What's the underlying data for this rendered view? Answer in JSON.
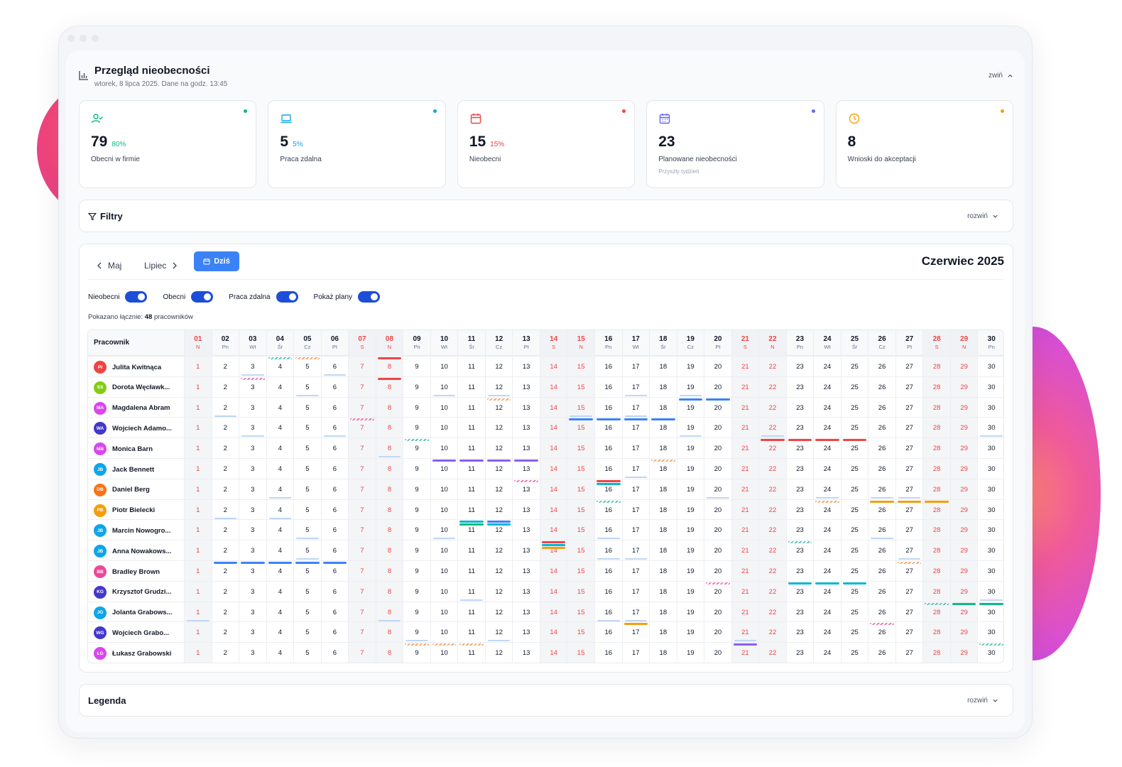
{
  "header": {
    "title": "Przegląd nieobecności",
    "subtitle": "wtorek, 8 lipca 2025. Dane na godz. 13:45",
    "collapse_label": "zwiń"
  },
  "cards": [
    {
      "icon": "user-check-icon",
      "value": "79",
      "percent": "80%",
      "label": "Obecni w firmie",
      "sub": "",
      "color": "#10b981"
    },
    {
      "icon": "laptop-icon",
      "value": "5",
      "percent": "5%",
      "label": "Praca zdalna",
      "sub": "",
      "color": "#0ea5e9"
    },
    {
      "icon": "calendar-x-icon",
      "value": "15",
      "percent": "15%",
      "label": "Nieobecni",
      "sub": "",
      "color": "#ef4444"
    },
    {
      "icon": "calendar-grid-icon",
      "value": "23",
      "percent": "",
      "label": "Planowane nieobecności",
      "sub": "Przyszły tydzień",
      "color": "#6366f1"
    },
    {
      "icon": "clock-icon",
      "value": "8",
      "percent": "",
      "label": "Wnioski do akceptacji",
      "sub": "",
      "color": "#f59e0b"
    }
  ],
  "filters": {
    "title": "Filtry",
    "expand_label": "rozwiń"
  },
  "calendar": {
    "prev_label": "Maj",
    "next_label": "Lipiec",
    "today_label": "Dziś",
    "month_title": "Czerwiec 2025",
    "toggles": [
      {
        "label": "Nieobecni",
        "on": true
      },
      {
        "label": "Obecni",
        "on": true
      },
      {
        "label": "Praca zdalna",
        "on": true
      },
      {
        "label": "Pokaż plany",
        "on": true
      }
    ],
    "total_prefix": "Pokazano łącznie:",
    "total_count": "48",
    "total_suffix": "pracowników",
    "employee_col": "Pracownik",
    "days": [
      {
        "d": "01",
        "w": "N",
        "we": true
      },
      {
        "d": "02",
        "w": "Pn"
      },
      {
        "d": "03",
        "w": "Wt"
      },
      {
        "d": "04",
        "w": "Śr"
      },
      {
        "d": "05",
        "w": "Cz"
      },
      {
        "d": "06",
        "w": "Pt"
      },
      {
        "d": "07",
        "w": "S",
        "we": true
      },
      {
        "d": "08",
        "w": "N",
        "we": true
      },
      {
        "d": "09",
        "w": "Pn"
      },
      {
        "d": "10",
        "w": "Wt"
      },
      {
        "d": "11",
        "w": "Śr"
      },
      {
        "d": "12",
        "w": "Cz"
      },
      {
        "d": "13",
        "w": "Pt"
      },
      {
        "d": "14",
        "w": "S",
        "we": true
      },
      {
        "d": "15",
        "w": "N",
        "we": true
      },
      {
        "d": "16",
        "w": "Pn"
      },
      {
        "d": "17",
        "w": "Wt"
      },
      {
        "d": "18",
        "w": "Śr"
      },
      {
        "d": "19",
        "w": "Cz"
      },
      {
        "d": "20",
        "w": "Pt"
      },
      {
        "d": "21",
        "w": "S",
        "we": true
      },
      {
        "d": "22",
        "w": "N",
        "we": true
      },
      {
        "d": "23",
        "w": "Pn"
      },
      {
        "d": "24",
        "w": "Wt"
      },
      {
        "d": "25",
        "w": "Śr"
      },
      {
        "d": "26",
        "w": "Cz"
      },
      {
        "d": "27",
        "w": "Pt"
      },
      {
        "d": "28",
        "w": "S",
        "we": true
      },
      {
        "d": "29",
        "w": "N",
        "we": true
      },
      {
        "d": "30",
        "w": "Pn"
      }
    ],
    "employees": [
      {
        "initials": "PI",
        "name": "Julita Kwitnąca",
        "color": "#ef4444",
        "marks": {
          "3": "ul",
          "4": "hatch:#5cc5b8",
          "5": "hatch:#f5a66b",
          "6": "ul",
          "8": "bar:#ef4444"
        }
      },
      {
        "initials": "SS",
        "name": "Dorota Węcławk...",
        "color": "#84cc16",
        "marks": {
          "3": "hatch:#e879b8",
          "5": "ul",
          "8": "bar:#ef4444",
          "10": "ul",
          "12": "ul",
          "17": "ul",
          "19": "ul"
        }
      },
      {
        "initials": "MA",
        "name": "Magdalena Abram",
        "color": "#d946ef",
        "marks": {
          "2": "ul",
          "12": "hatch:#f5a66b",
          "15": "ul",
          "17": "ul",
          "19": "bar:#3b82f6",
          "20": "bar:#3b82f6"
        }
      },
      {
        "initials": "WA",
        "name": "Wojciech Adamo...",
        "color": "#4338ca",
        "marks": {
          "3": "ul",
          "6": "ul",
          "7": "hatch:#e879b8",
          "15": "bar:#3b82f6",
          "16": "bar:#3b82f6",
          "17": "bar:#3b82f6",
          "18": "bar:#3b82f6",
          "19": "ul",
          "22": "ul",
          "30": "ul"
        }
      },
      {
        "initials": "MB",
        "name": "Monica Barn",
        "color": "#d946ef",
        "marks": {
          "8": "ul",
          "9": "hatch:#5cc5b8",
          "22": "bar:#ef4444",
          "23": "bar:#ef4444",
          "24": "bar:#ef4444",
          "25": "bar:#ef4444"
        }
      },
      {
        "initials": "JB",
        "name": "Jack Bennett",
        "color": "#0ea5e9",
        "marks": {
          "10": "bar:#8b5cf6",
          "11": "bar:#8b5cf6",
          "12": "bar:#8b5cf6",
          "13": "bar:#8b5cf6",
          "17": "ul",
          "18": "hatch:#f5a66b"
        }
      },
      {
        "initials": "DB",
        "name": "Daniel Berg",
        "color": "#f97316",
        "marks": {
          "4": "ul",
          "13": "hatch:#e879b8",
          "16": "bar:#ef4444|bar2:#06b6d4",
          "20": "ul",
          "24": "ul",
          "26": "ul",
          "27": "ul"
        }
      },
      {
        "initials": "PB",
        "name": "Piotr Bielecki",
        "color": "#f59e0b",
        "marks": {
          "2": "ul",
          "4": "ul",
          "16": "hatch:#5cc5b8",
          "24": "hatch:#f5a66b",
          "26": "bar:#f59e0b",
          "27": "bar:#f59e0b",
          "28": "bar:#f59e0b"
        }
      },
      {
        "initials": "JB",
        "name": "Marcin Nowogro...",
        "color": "#0ea5e9",
        "marks": {
          "5": "ul",
          "10": "ul",
          "11": "bar:#06b6d4|bar2:#10b981",
          "12": "bar:#3b82f6|bar2:#06b6d4",
          "16": "ul",
          "26": "ul"
        }
      },
      {
        "initials": "JB",
        "name": "Anna Nowakows...",
        "color": "#0ea5e9",
        "marks": {
          "5": "ul",
          "14": "bar:#ef4444|bar2:#06b6d4|bar3:#f59e0b",
          "16": "ul",
          "17": "ul",
          "23": "hatch:#5cc5b8",
          "27": "ul"
        }
      },
      {
        "initials": "BB",
        "name": "Bradley Brown",
        "color": "#ec4899",
        "marks": {
          "2": "bar:#3b82f6",
          "3": "bar:#3b82f6",
          "4": "bar:#3b82f6",
          "5": "bar:#3b82f6",
          "6": "bar:#3b82f6",
          "27": "hatch:#f5a66b"
        }
      },
      {
        "initials": "KG",
        "name": "Krzysztof Grudzi...",
        "color": "#4338ca",
        "marks": {
          "11": "ul",
          "20": "hatch:#e879b8",
          "23": "bar:#06b6d4",
          "24": "bar:#06b6d4",
          "25": "bar:#06b6d4",
          "30": "ul"
        }
      },
      {
        "initials": "JG",
        "name": "Jolanta Grabows...",
        "color": "#0ea5e9",
        "marks": {
          "1": "ul",
          "8": "ul",
          "16": "ul",
          "17": "ul",
          "28": "hatch:#5cc5b8",
          "29": "bar:#10b981",
          "30": "bar:#10b981"
        }
      },
      {
        "initials": "WG",
        "name": "Wojciech Grabo...",
        "color": "#4338ca",
        "marks": {
          "9": "ul",
          "12": "ul",
          "17": "bar:#f59e0b",
          "21": "ul",
          "26": "hatch:#e879b8"
        }
      },
      {
        "initials": "ŁG",
        "name": "Łukasz Grabowski",
        "color": "#d946ef",
        "marks": {
          "9": "hatch:#f5a66b",
          "10": "hatch:#f5a66b",
          "11": "hatch:#f5a66b",
          "21": "bar:#8b5cf6",
          "30": "hatch:#5cc5b8"
        }
      }
    ]
  },
  "legend": {
    "title": "Legenda",
    "expand_label": "rozwiń"
  }
}
